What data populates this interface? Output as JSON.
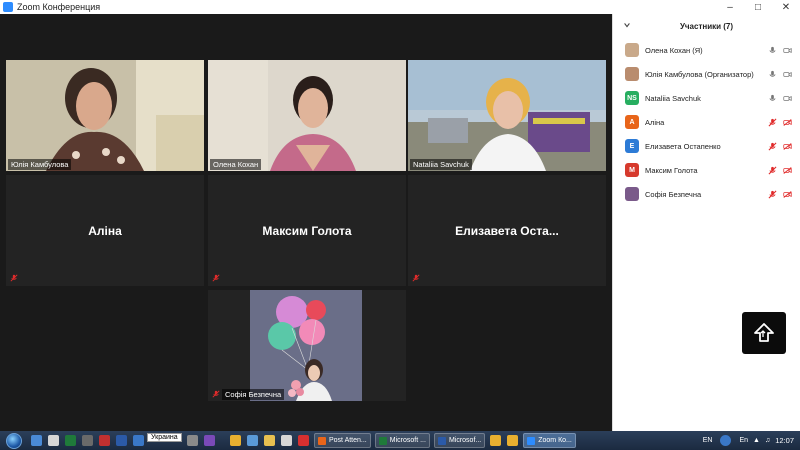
{
  "window": {
    "title": "Zoom Конференция"
  },
  "tiles": [
    {
      "name": "Юлія Камбулова",
      "kind": "video",
      "active": true
    },
    {
      "name": "Олена Кохан",
      "kind": "video"
    },
    {
      "name": "Nataliia Savchuk",
      "kind": "video"
    },
    {
      "name": "Аліна",
      "kind": "name"
    },
    {
      "name": "Максим Голота",
      "kind": "name"
    },
    {
      "name": "Елизавета Оста...",
      "kind": "name"
    },
    {
      "name": "Софія Безпечна",
      "kind": "video"
    }
  ],
  "participants": {
    "title": "Участники (7)",
    "items": [
      {
        "name": "Олена Кохан (Я)",
        "initials": "",
        "color": "#c9a98a",
        "mic": "on",
        "cam": "on"
      },
      {
        "name": "Юлія Камбулова (Организатор)",
        "initials": "",
        "color": "#b98c6e",
        "mic": "on",
        "cam": "on"
      },
      {
        "name": "Nataliia Savchuk",
        "initials": "NS",
        "color": "#27ae60",
        "mic": "on",
        "cam": "on"
      },
      {
        "name": "Аліна",
        "initials": "А",
        "color": "#e8651a",
        "mic": "muted",
        "cam": "off"
      },
      {
        "name": "Елизавета Остапенко",
        "initials": "Е",
        "color": "#2d7bd6",
        "mic": "muted",
        "cam": "off"
      },
      {
        "name": "Максим Голота",
        "initials": "М",
        "color": "#d63a2d",
        "mic": "muted",
        "cam": "off"
      },
      {
        "name": "Софія Безпечна",
        "initials": "",
        "color": "#7a5a8a",
        "mic": "muted",
        "cam": "off"
      }
    ]
  },
  "taskbar": {
    "tooltip": "Украина",
    "apps": [
      {
        "label": "Post Atten...",
        "color": "#e8651a"
      },
      {
        "label": "Microsoft ...",
        "color": "#1f7a3a"
      },
      {
        "label": "Microsof...",
        "color": "#2b5aa8"
      },
      {
        "label": "Zoom Ко...",
        "color": "#2d8cff",
        "active": true
      }
    ],
    "lang": "EN",
    "lang2": "En",
    "clock": "12:07"
  },
  "colors": {
    "accent": "#2d8cff",
    "muted": "#e02b2b",
    "active_border": "#e6e23a"
  }
}
